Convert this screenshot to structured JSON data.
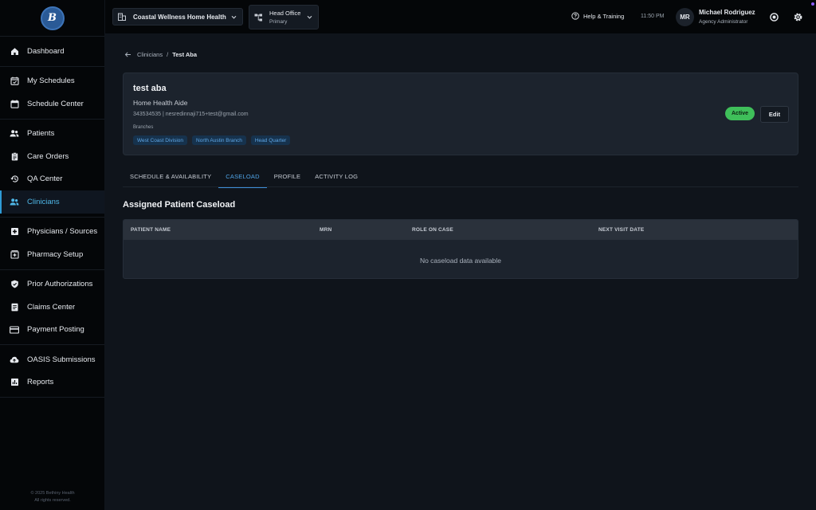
{
  "sidebar": {
    "logo_text": "B",
    "groups": [
      [
        {
          "label": "Dashboard",
          "icon": "home-icon"
        }
      ],
      [
        {
          "label": "My Schedules",
          "icon": "calendar-check-icon"
        },
        {
          "label": "Schedule Center",
          "icon": "calendar-icon"
        }
      ],
      [
        {
          "label": "Patients",
          "icon": "users-icon"
        },
        {
          "label": "Care Orders",
          "icon": "clipboard-icon"
        },
        {
          "label": "QA Center",
          "icon": "history-icon"
        },
        {
          "label": "Clinicians",
          "icon": "clinicians-icon",
          "active": true
        }
      ],
      [
        {
          "label": "Physicians / Sources",
          "icon": "medical-plus-icon"
        },
        {
          "label": "Pharmacy Setup",
          "icon": "pharmacy-icon"
        }
      ],
      [
        {
          "label": "Prior Authorizations",
          "icon": "shield-check-icon"
        },
        {
          "label": "Claims Center",
          "icon": "claims-icon"
        },
        {
          "label": "Payment Posting",
          "icon": "credit-card-icon"
        }
      ],
      [
        {
          "label": "OASIS Submissions",
          "icon": "cloud-upload-icon"
        },
        {
          "label": "Reports",
          "icon": "bar-chart-icon"
        }
      ]
    ],
    "footer_line1": "© 2025 Bethiny Health",
    "footer_line2": "All rights reserved."
  },
  "topbar": {
    "org_name": "Coastal Wellness Home Health",
    "branch_name": "Head Office",
    "branch_sub": "Primary",
    "help_label": "Help & Training",
    "time": "11:50 PM",
    "user_initials": "MR",
    "user_name": "Michael Rodriguez",
    "user_role": "Agency Administrator"
  },
  "breadcrumb": {
    "parent": "Clinicians",
    "separator": "/",
    "current": "Test Aba"
  },
  "profile": {
    "name": "test aba",
    "role": "Home Health Aide",
    "contact": "343534535 | nesredinnaji715+test@gmail.com",
    "branches_label": "Branches",
    "branches": [
      "West Coast Division",
      "North Austin Branch",
      "Head Quarter"
    ],
    "status": "Active",
    "edit_label": "Edit"
  },
  "tabs": [
    {
      "label": "SCHEDULE & AVAILABILITY"
    },
    {
      "label": "CASELOAD",
      "active": true
    },
    {
      "label": "PROFILE"
    },
    {
      "label": "ACTIVITY LOG"
    }
  ],
  "caseload": {
    "title": "Assigned Patient Caseload",
    "columns": [
      "PATIENT NAME",
      "MRN",
      "ROLE ON CASE",
      "NEXT VISIT DATE"
    ],
    "empty_text": "No caseload data available"
  },
  "colors": {
    "accent": "#4fa3e6",
    "active_status": "#3fbf5a",
    "chip_bg": "#16324d"
  }
}
